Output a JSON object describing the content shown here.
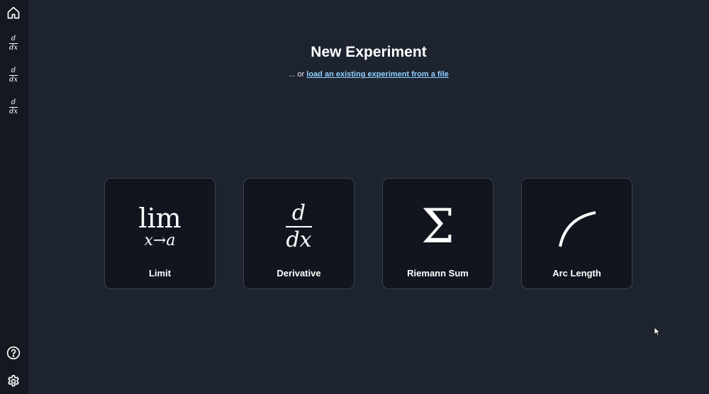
{
  "sidebar": {
    "home_icon": "home-icon",
    "items": [
      {
        "num": "d",
        "den": "dx"
      },
      {
        "num": "d",
        "den": "dx"
      },
      {
        "num": "d",
        "den": "dx"
      }
    ],
    "help_icon": "help-icon",
    "settings_icon": "gear-icon"
  },
  "header": {
    "title": "New Experiment",
    "subtitle_prefix": "... or",
    "subtitle_link": "load an existing experiment from a file"
  },
  "cards": [
    {
      "label": "Limit",
      "glyph_top": "lim",
      "glyph_bottom": "x→a"
    },
    {
      "label": "Derivative",
      "glyph_num": "d",
      "glyph_den": "dx"
    },
    {
      "label": "Riemann Sum",
      "glyph": "Σ"
    },
    {
      "label": "Arc Length",
      "glyph_icon": "arc-icon"
    }
  ],
  "colors": {
    "background": "#1e2330",
    "sidebar": "#141820",
    "card": "#11151e",
    "card_border": "#3a404d",
    "link": "#8fd0ff"
  }
}
